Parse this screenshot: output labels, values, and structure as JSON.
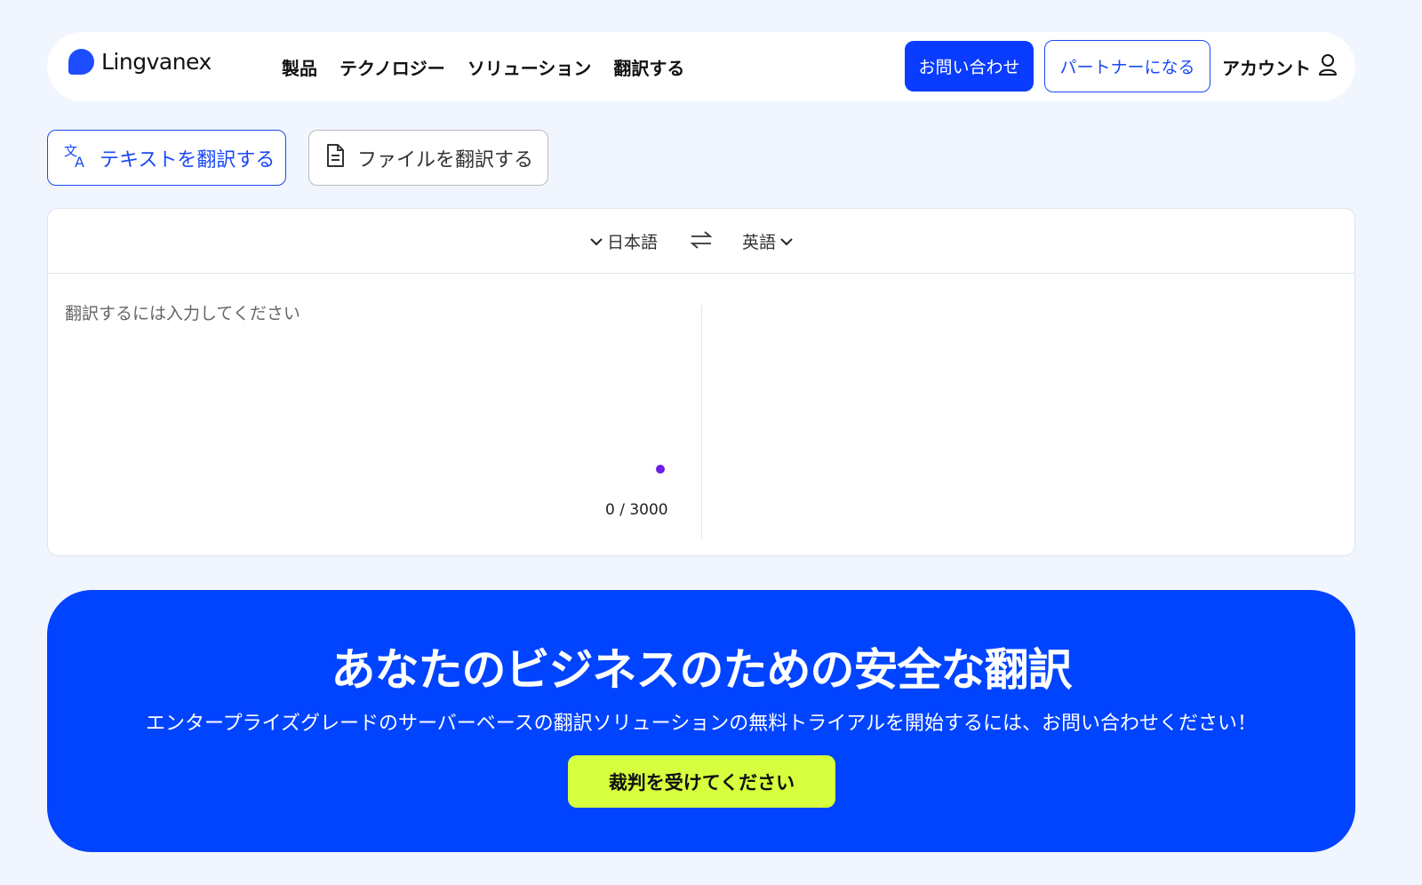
{
  "brand": {
    "name": "Lingvanex",
    "color": "#1e4dff"
  },
  "nav": {
    "items": [
      {
        "label": "製品"
      },
      {
        "label": "テクノロジー"
      },
      {
        "label": "ソリューション"
      },
      {
        "label": "翻訳する"
      }
    ],
    "contact_label": "お問い合わせ",
    "partner_label": "パートナーになる",
    "account_label": "アカウント",
    "account_icon": "user-icon"
  },
  "modes": {
    "text": {
      "label": "テキストを翻訳する",
      "icon": "translate-icon",
      "active": true
    },
    "file": {
      "label": "ファイルを翻訳する",
      "icon": "document-icon",
      "active": false
    }
  },
  "translator": {
    "source_lang": "日本語",
    "target_lang": "英語",
    "swap_icon": "swap-arrows-icon",
    "placeholder": "翻訳するには入力してください",
    "input_value": "",
    "char_count": "0 / 3000"
  },
  "promo": {
    "title": "あなたのビジネスのための安全な翻訳",
    "subtitle": "エンタープライズグレードのサーバーベースの翻訳ソリューションの無料トライアルを開始するには、お問い合わせください！",
    "cta_label": "裁判を受けてください",
    "background": "#0044ff",
    "cta_color": "#d6ff3d"
  }
}
